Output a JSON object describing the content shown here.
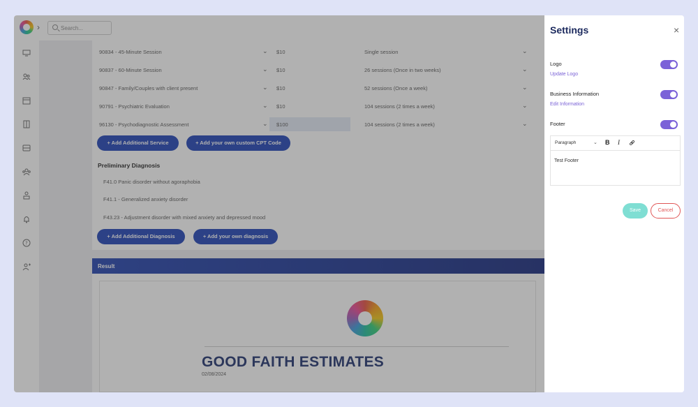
{
  "header": {
    "search_placeholder": "Search...",
    "chevron": "›",
    "logo": "app-logo"
  },
  "sidebar": {
    "icons": [
      "monitor-icon",
      "users-icon",
      "calendar-icon",
      "building-icon",
      "inbox-icon",
      "group-icon",
      "org-icon",
      "bell-icon",
      "help-icon",
      "add-user-icon"
    ]
  },
  "services": [
    {
      "code": "90834 - 45-Minute Session",
      "price": "$10",
      "frequency": "Single session"
    },
    {
      "code": "90837 - 60-Minute Session",
      "price": "$10",
      "frequency": "26 sessions (Once in two weeks)"
    },
    {
      "code": "90847 - Family/Couples with client present",
      "price": "$10",
      "frequency": "52 sessions (Once a week)"
    },
    {
      "code": "90791 - Psychiatric Evaluation",
      "price": "$10",
      "frequency": "104 sessions (2 times a week)"
    },
    {
      "code": "96130 - Psychodiagnostic Assessment",
      "price": "$100",
      "frequency": "104 sessions (2 times a week)"
    }
  ],
  "buttons": {
    "add_service": "+ Add Additional Service",
    "add_cpt": "+ Add your own custom CPT Code",
    "add_diagnosis": "+ Add Additional Diagnosis",
    "add_own_diagnosis": "+ Add your own diagnosis"
  },
  "diagnosis": {
    "title": "Preliminary Diagnosis",
    "items": [
      "F41.0 Panic disorder without agoraphobia",
      "F41.1 - Generalized anxiety disorder",
      "F43.23 - Adjustment disorder with mixed anxiety and depressed mood"
    ]
  },
  "result": {
    "label": "Result",
    "doc_title": "GOOD FAITH ESTIMATES",
    "doc_date": "02/08/2024"
  },
  "settings": {
    "title": "Settings",
    "close": "×",
    "logo_label": "Logo",
    "logo_link": "Update Logo",
    "business_label": "Business Information",
    "business_link": "Edit Information",
    "footer_label": "Footer",
    "editor_format": "Paragraph",
    "editor_bold": "B",
    "editor_italic": "I",
    "editor_link": "🔗",
    "footer_text": "Test Footer",
    "save": "Save",
    "cancel": "Cancel",
    "toggle_color": "#7b62d8"
  }
}
